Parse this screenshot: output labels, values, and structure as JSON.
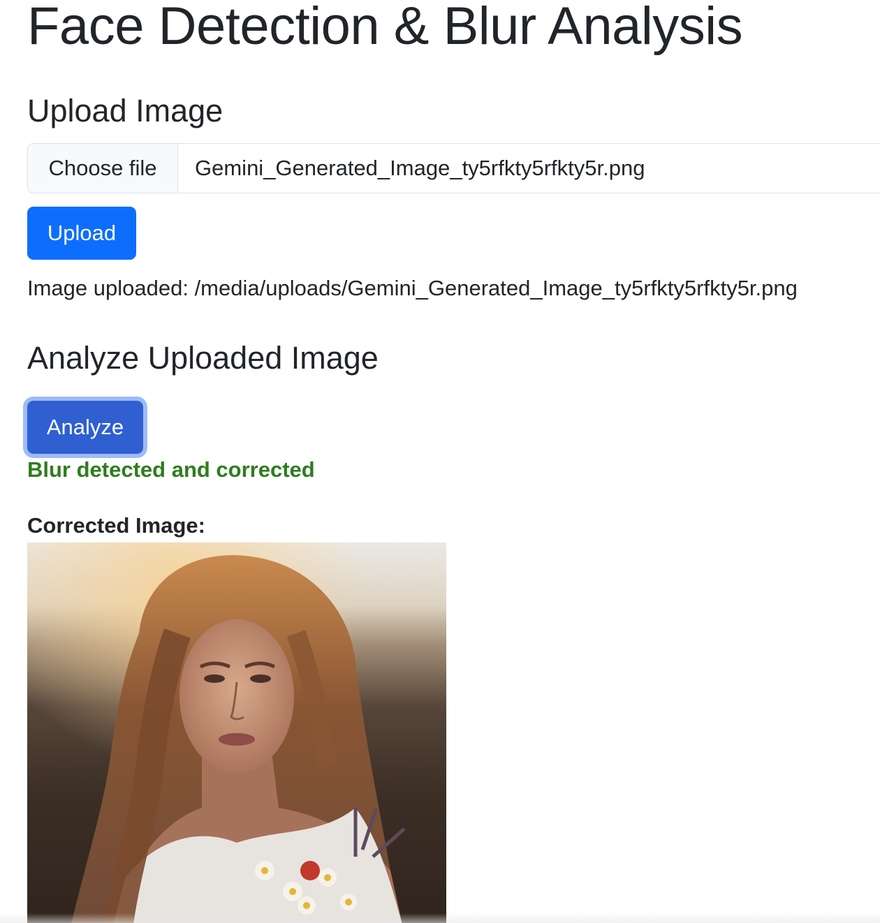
{
  "page": {
    "title": "Face Detection & Blur Analysis"
  },
  "upload_section": {
    "heading": "Upload Image",
    "choose_file_label": "Choose file",
    "selected_file_name": "Gemini_Generated_Image_ty5rfkty5rfkty5r.png",
    "upload_button_label": "Upload",
    "status_text": "Image uploaded: /media/uploads/Gemini_Generated_Image_ty5rfkty5rfkty5r.png"
  },
  "analyze_section": {
    "heading": "Analyze Uploaded Image",
    "analyze_button_label": "Analyze",
    "result_message": "Blur detected and corrected",
    "corrected_image_label": "Corrected Image:"
  },
  "colors": {
    "primary_button": "#0d6efd",
    "focused_button": "#2f5fd1",
    "success_text": "#2e7d1f"
  }
}
